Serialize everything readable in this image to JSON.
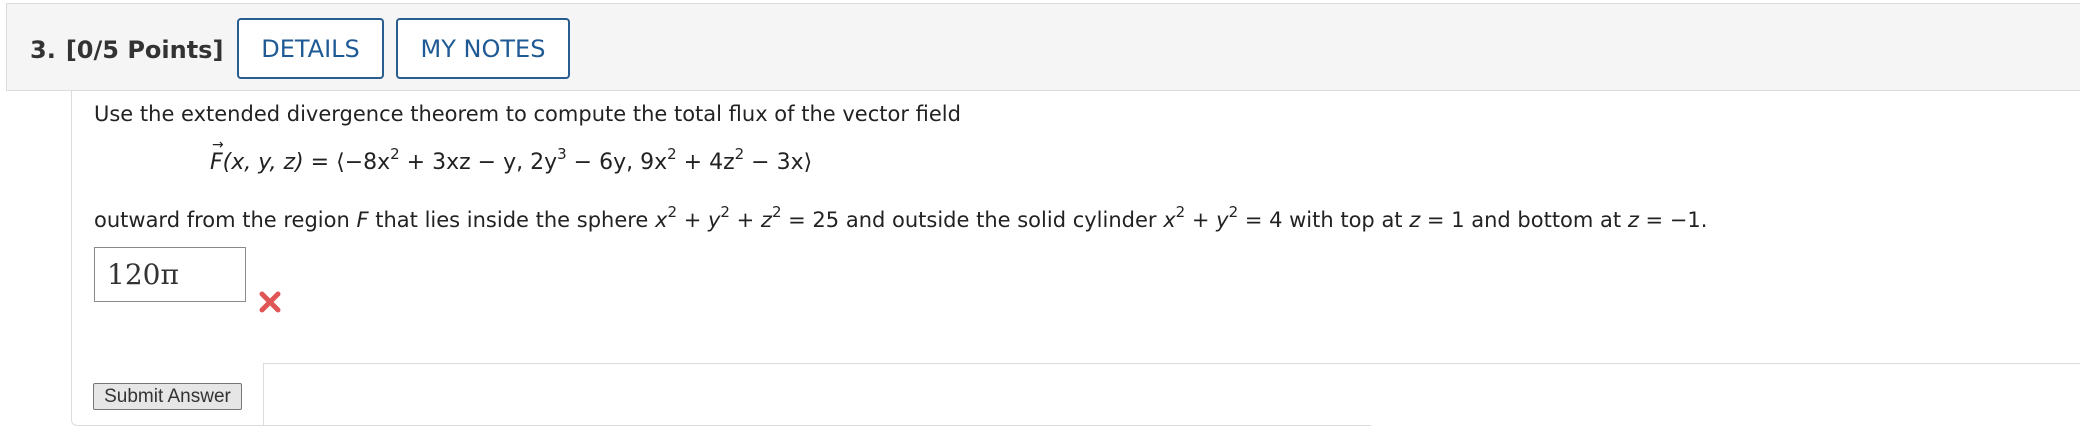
{
  "question": {
    "number": "3.",
    "points": "[0/5 Points]",
    "details_label": "DETAILS",
    "notes_label": "MY NOTES"
  },
  "prompt": "Use the extended divergence theorem to compute the total flux of the vector field",
  "formula": {
    "func": "F(x, y, z)",
    "equals": " = ",
    "langle": "⟨",
    "c1_a": "−8x",
    "c1_b": " + 3xz − y, 2y",
    "c2_a": " − 6y, 9x",
    "c3_a": " + 4z",
    "c3_b": " − 3x",
    "rangle": "⟩",
    "exp2": "2",
    "exp3": "3"
  },
  "outward": {
    "p1": "outward from the region ",
    "region": "F",
    "p2": " that lies inside the sphere ",
    "x": "x",
    "plus": " + ",
    "y": "y",
    "z": "z",
    "eq25": " = 25 and outside the solid cylinder ",
    "eq4": " = 4 with top at ",
    "top_val": " = 1 and bottom at ",
    "bottom_val": " = −1.",
    "exp": "2"
  },
  "answer": {
    "value": "120π",
    "status_icon": "x-mark-icon",
    "status_color": "#e05555"
  },
  "submit_label": "Submit Answer",
  "colors": {
    "accent": "#1f5a94",
    "header_bg": "#f5f5f5"
  }
}
